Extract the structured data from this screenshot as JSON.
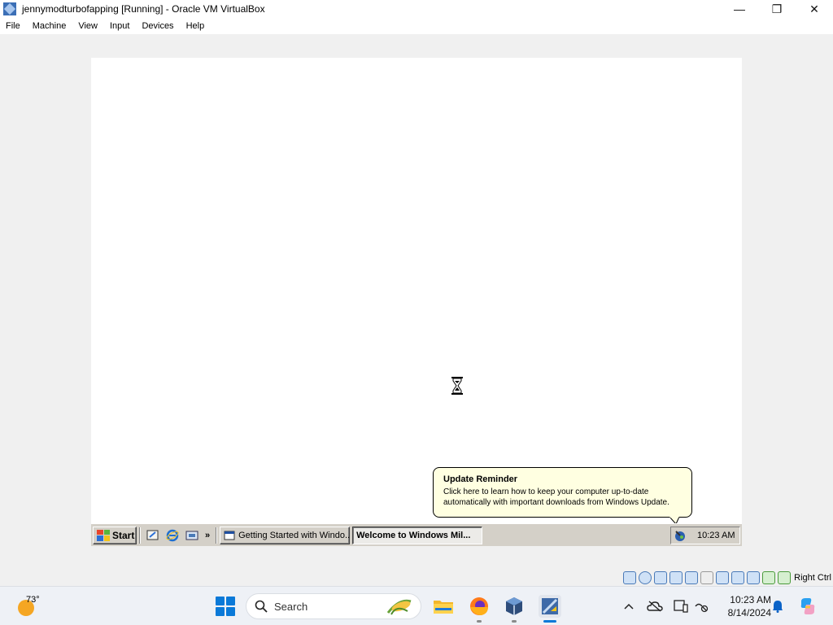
{
  "window": {
    "title": "jennymodturbofapping [Running] - Oracle VM VirtualBox",
    "minimize": "—",
    "maximize": "❐",
    "close": "✕"
  },
  "menubar": [
    "File",
    "Machine",
    "View",
    "Input",
    "Devices",
    "Help"
  ],
  "guest": {
    "balloon": {
      "title": "Update Reminder",
      "body_line1": "Click here to learn how to keep your computer up-to-date",
      "body_line2": "automatically with important downloads from Windows Update."
    },
    "taskbar": {
      "start_label": "Start",
      "quick_launch_overflow": "»",
      "tasks": [
        {
          "label": "Getting Started with Windo...",
          "active": false
        },
        {
          "label": "Welcome to Windows Mil...",
          "active": true
        }
      ],
      "clock": "10:23 AM"
    }
  },
  "vbox_status": {
    "host_key": "Right Ctrl",
    "icons": [
      "hard-disk-icon",
      "optical-drive-icon",
      "audio-icon",
      "network-icon",
      "usb-icon",
      "shared-folders-icon",
      "display-icon",
      "video-capture-icon",
      "cpu-icon",
      "recording-icon",
      "mouse-integration-icon",
      "keyboard-icon"
    ]
  },
  "host_taskbar": {
    "weather_temp": "73°",
    "search_placeholder": "Search",
    "apps": [
      "file-explorer-icon",
      "firefox-icon",
      "virtualbox-icon",
      "vm-xp-icon"
    ],
    "clock_time": "10:23 AM",
    "clock_date": "8/14/2024",
    "accent": "#0a79d8"
  }
}
